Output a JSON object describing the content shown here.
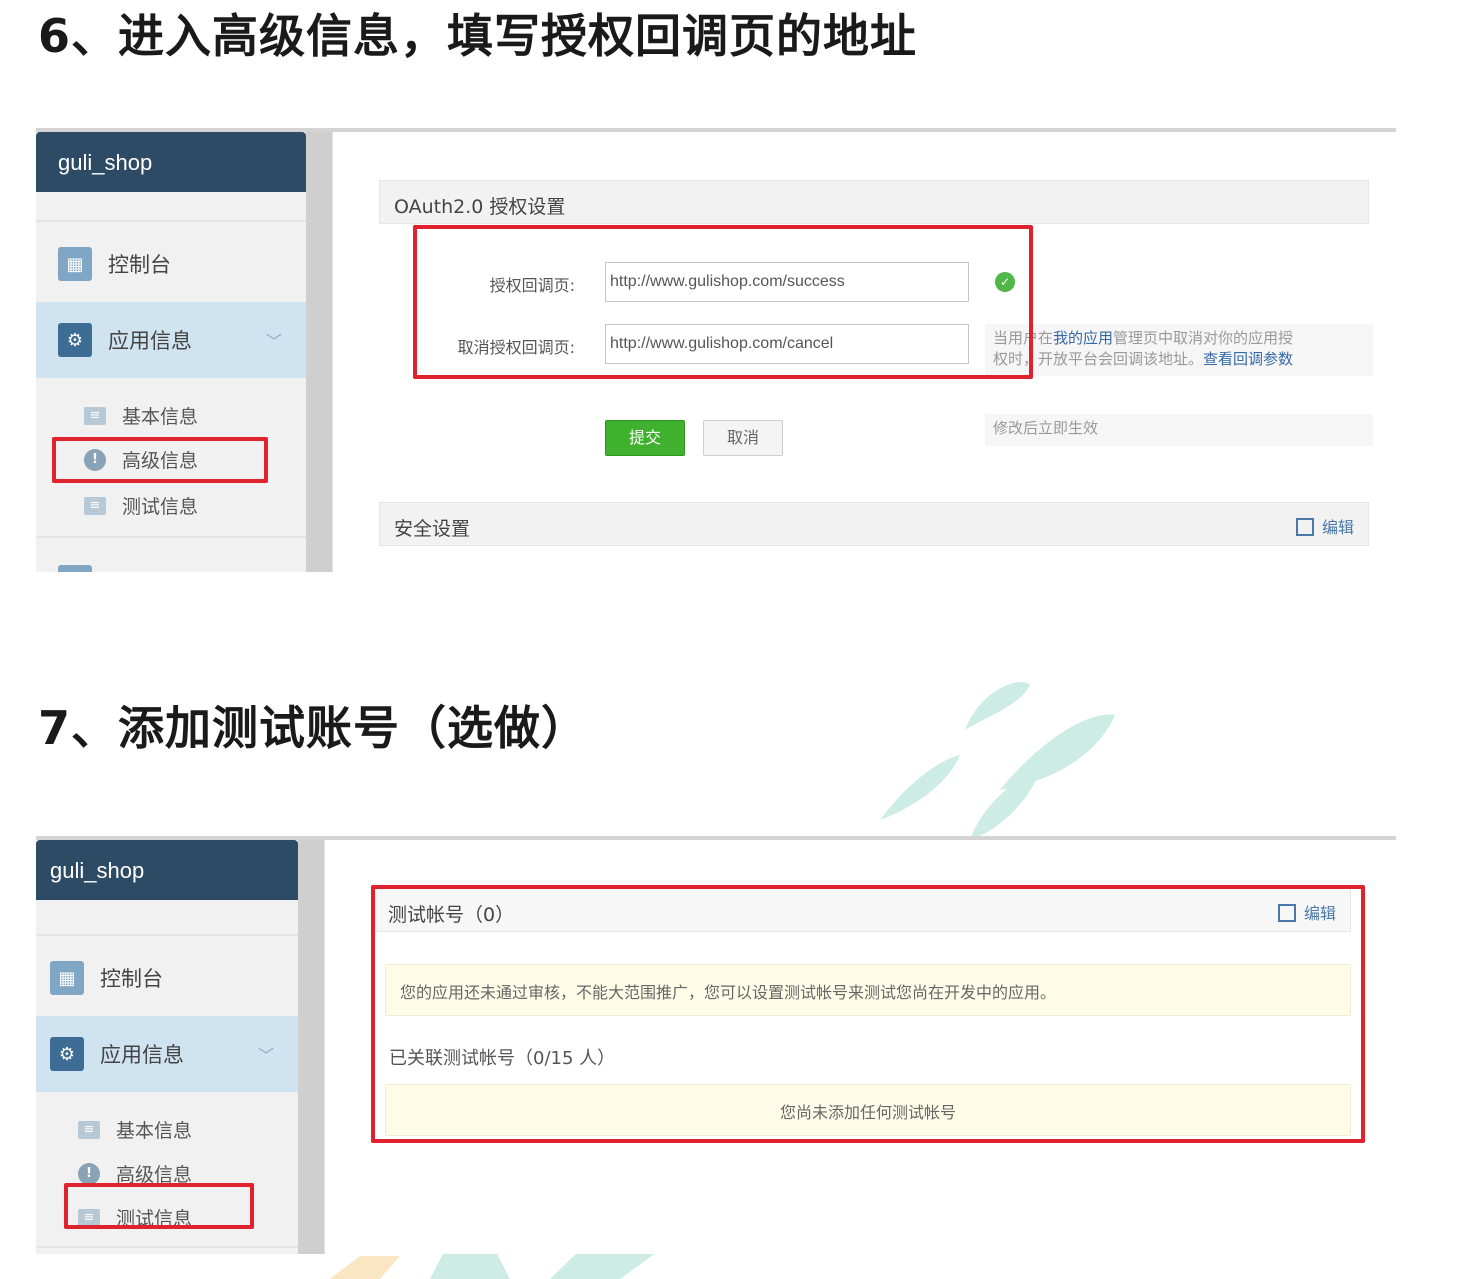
{
  "step6": {
    "title": "6、进入高级信息，填写授权回调页的地址",
    "app_name": "guli_shop",
    "nav": {
      "console": "控制台",
      "app_info": "应用信息"
    },
    "sub_nav": {
      "basic": "基本信息",
      "advanced": "高级信息",
      "test": "测试信息"
    },
    "oauth_section": "OAuth2.0 授权设置",
    "callback_label": "授权回调页:",
    "callback_value": "http://www.gulishop.com/success",
    "cancel_label": "取消授权回调页:",
    "cancel_value": "http://www.gulishop.com/cancel",
    "cancel_hint_1": "当用户在",
    "cancel_hint_link": "我的应用",
    "cancel_hint_2": "管理页中取消对你的应用授",
    "cancel_hint_3": "权时，开放平台会回调该地址。",
    "cancel_hint_link2": "查看回调参数",
    "submit": "提交",
    "cancel": "取消",
    "effect_hint": "修改后立即生效",
    "security_section": "安全设置",
    "edit": "编辑"
  },
  "step7": {
    "title": "7、添加测试账号（选做）",
    "app_name": "guli_shop",
    "nav": {
      "console": "控制台",
      "app_info": "应用信息"
    },
    "sub_nav": {
      "basic": "基本信息",
      "advanced": "高级信息",
      "test": "测试信息"
    },
    "section": "测试帐号（0）",
    "edit": "编辑",
    "notice": "您的应用还未通过审核，不能大范围推广，您可以设置测试帐号来测试您尚在开发中的应用。",
    "linked": "已关联测试帐号（0/15 人）",
    "empty": "您尚未添加任何测试帐号"
  },
  "colors": {
    "header": "#2e4b66",
    "highlight": "#e0212e",
    "submit": "#3fb12e",
    "active_nav": "#cfe3f0",
    "watermark": "#8fd0c4"
  },
  "icons": [
    "console-icon",
    "gear-icon",
    "chevron-down-icon",
    "card-icon",
    "exclamation-icon",
    "check-circle-icon",
    "edit-icon"
  ]
}
